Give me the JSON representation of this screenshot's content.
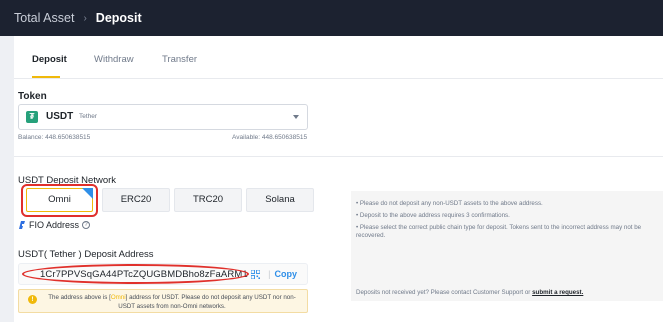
{
  "breadcrumb": {
    "root": "Total Asset",
    "separator": "›",
    "current": "Deposit"
  },
  "tabs": [
    {
      "label": "Deposit",
      "active": true
    },
    {
      "label": "Withdraw",
      "active": false
    },
    {
      "label": "Transfer",
      "active": false
    }
  ],
  "token": {
    "heading": "Token",
    "symbol": "USDT",
    "name": "Tether",
    "icon": "tether-icon",
    "balance": "Balance: 448.650638515",
    "available": "Available: 448.650638515"
  },
  "network": {
    "heading": "USDT Deposit Network",
    "options": [
      {
        "label": "Omni",
        "selected": true
      },
      {
        "label": "ERC20",
        "selected": false
      },
      {
        "label": "TRC20",
        "selected": false
      },
      {
        "label": "Solana",
        "selected": false
      }
    ]
  },
  "fio": {
    "label": "FIO Address",
    "help": "?"
  },
  "address": {
    "heading": "USDT( Tether ) Deposit Address",
    "value": "1Cr7PPVSqGA44PTcZQUGBMDBho8zFaARM1",
    "copy_label": "Copy",
    "separator": "|"
  },
  "warning": {
    "prefix": "The address above is [",
    "highlight": "Omni",
    "suffix": "] address for USDT. Please do not deposit any USDT nor non-USDT assets from non-Omni networks."
  },
  "info": {
    "lines": [
      "• Please do not deposit any non-USDT assets to the above address.",
      "• Deposit to the above address requires 3 confirmations.",
      "• Please select the correct public chain type for deposit. Tokens sent to the incorrect address may not be recovered."
    ],
    "support_prefix": "Deposits not received yet? Please contact Customer Support or",
    "support_link": "submit a request."
  },
  "colors": {
    "accent": "#f0b90b",
    "link": "#2f8fe8",
    "topbar": "#1c2230",
    "annotation": "#e0302b"
  }
}
